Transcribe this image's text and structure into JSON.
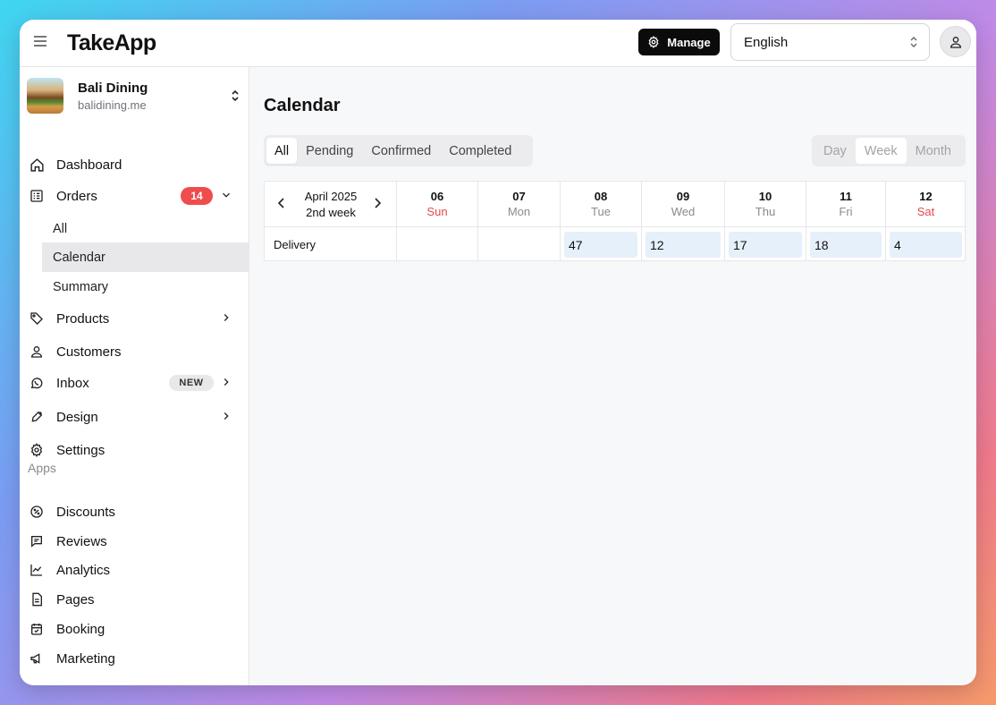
{
  "app": {
    "logo": "TakeApp"
  },
  "header": {
    "manage_label": "Manage",
    "language": "English",
    "icons": {
      "menu": "hamburger-icon",
      "manage": "gear-icon",
      "user": "user-icon",
      "lang": "chevron-up-down-icon"
    }
  },
  "store": {
    "name": "Bali Dining",
    "domain": "balidining.me"
  },
  "sidebar": {
    "dashboard": "Dashboard",
    "orders": {
      "label": "Orders",
      "badge": "14",
      "sub": [
        "All",
        "Calendar",
        "Summary"
      ],
      "active_sub": "Calendar"
    },
    "products": "Products",
    "customers": "Customers",
    "inbox": {
      "label": "Inbox",
      "badge": "NEW"
    },
    "design": "Design",
    "settings": "Settings",
    "apps_section": "Apps",
    "apps": [
      "Discounts",
      "Reviews",
      "Analytics",
      "Pages",
      "Booking",
      "Marketing"
    ]
  },
  "main": {
    "title": "Calendar",
    "filters": [
      "All",
      "Pending",
      "Confirmed",
      "Completed"
    ],
    "active_filter": "All",
    "views": [
      "Day",
      "Week",
      "Month"
    ],
    "active_view": "Week",
    "calendar": {
      "period_month": "April 2025",
      "period_week": "2nd week",
      "days": [
        {
          "num": "06",
          "name": "Sun"
        },
        {
          "num": "07",
          "name": "Mon"
        },
        {
          "num": "08",
          "name": "Tue"
        },
        {
          "num": "09",
          "name": "Wed"
        },
        {
          "num": "10",
          "name": "Thu"
        },
        {
          "num": "11",
          "name": "Fri"
        },
        {
          "num": "12",
          "name": "Sat"
        }
      ],
      "row_label": "Delivery",
      "counts": [
        "",
        "",
        "47",
        "12",
        "17",
        "18",
        "4"
      ]
    }
  },
  "colors": {
    "weekend": "#e5484d",
    "badge": "#ef4d4d",
    "chip": "#e6f0fb"
  }
}
